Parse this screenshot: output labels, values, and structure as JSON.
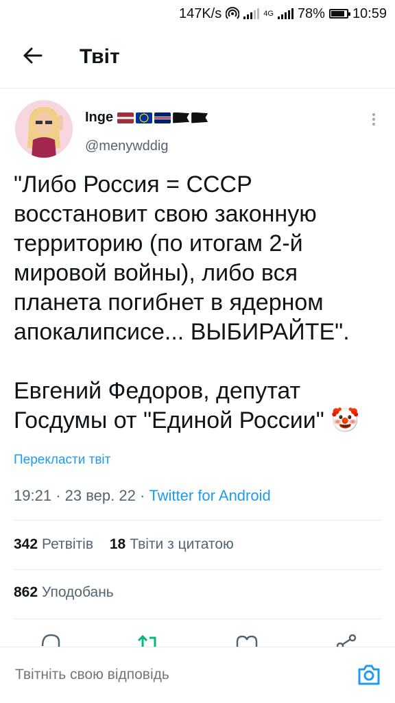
{
  "status_bar": {
    "speed": "147K/s",
    "network": "4G",
    "battery": "78%",
    "time": "10:59"
  },
  "header": {
    "title": "Твіт"
  },
  "tweet": {
    "author_name": "Inge",
    "handle": "@menywddig",
    "text": "\"Либо Россия = СССР восстановит свою законную территорию (по итогам 2-й мировой войны), либо вся планета погибнет в ядерном апокалипсисе... ВЫБИРАЙТЕ\".\n\nЕвгений Федоров, депутат Госдумы от \"Единой России\" 🤡",
    "translate_label": "Перекласти твіт",
    "time": "19:21",
    "date": "23 вер. 22",
    "source": "Twitter for Android"
  },
  "stats": {
    "retweets_count": "342",
    "retweets_label": "Ретвітів",
    "quotes_count": "18",
    "quotes_label": "Твіти з цитатою",
    "likes_count": "862",
    "likes_label": "Уподобань"
  },
  "reply": {
    "placeholder": "Твітніть свою відповідь"
  },
  "colors": {
    "accent": "#1d9bf0",
    "retweet": "#00ba7c",
    "muted": "#536471"
  }
}
